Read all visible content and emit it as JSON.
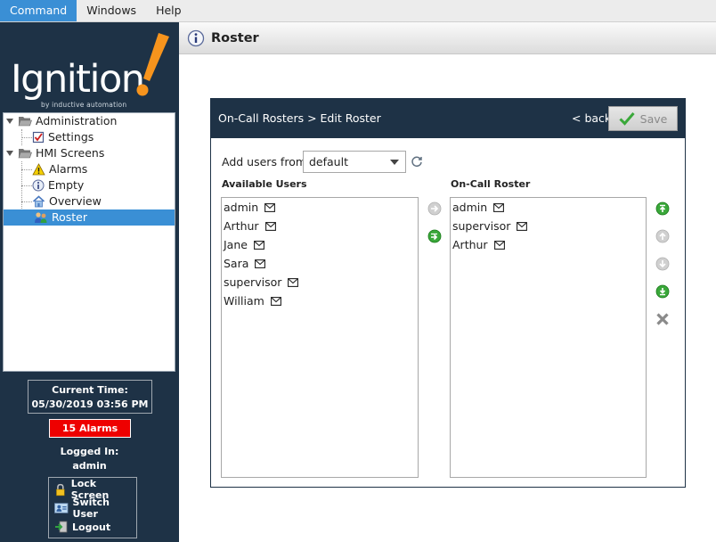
{
  "menu": {
    "items": [
      "Command",
      "Windows",
      "Help"
    ]
  },
  "logo": {
    "word": "Ignition",
    "tagline": "by inductive automation"
  },
  "nav": {
    "administration": "Administration",
    "settings": "Settings",
    "hmi_screens": "HMI Screens",
    "alarms": "Alarms",
    "empty": "Empty",
    "overview": "Overview",
    "roster": "Roster"
  },
  "status": {
    "time_label": "Current Time:",
    "time_value": "05/30/2019 03:56 PM",
    "alarms": "15 Alarms",
    "logged_label": "Logged In:",
    "logged_user": "admin"
  },
  "actions": {
    "lock": "Lock Screen",
    "switch": "Switch User",
    "logout": "Logout"
  },
  "header": {
    "title": "Roster"
  },
  "panel": {
    "breadcrumb": "On-Call Rosters > Edit Roster",
    "back": "< back",
    "save": "Save",
    "add_users_label": "Add users from",
    "source_value": "default",
    "available_title": "Available Users",
    "roster_title": "On-Call Roster"
  },
  "available_users": [
    "admin",
    "Arthur",
    "Jane",
    "Sara",
    "supervisor",
    "William"
  ],
  "roster_users": [
    "admin",
    "supervisor",
    "Arthur"
  ],
  "colors": {
    "sidebar": "#1e3246",
    "selection": "#3a8fd5",
    "alarm": "#ee0000",
    "green": "#3aa83a"
  }
}
